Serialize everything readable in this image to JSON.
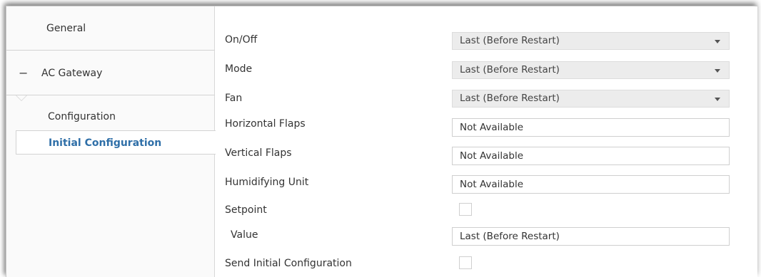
{
  "sidebar": {
    "general": "General",
    "ac_gateway": {
      "toggle": "−",
      "label": "AC Gateway"
    },
    "configuration": "Configuration",
    "initial_configuration": "Initial Configuration"
  },
  "params": {
    "on_off": {
      "label": "On/Off",
      "value": "Last (Before Restart)"
    },
    "mode": {
      "label": "Mode",
      "value": "Last (Before Restart)"
    },
    "fan": {
      "label": "Fan",
      "value": "Last (Before Restart)"
    },
    "horizontal_flaps": {
      "label": "Horizontal Flaps",
      "value": "Not Available"
    },
    "vertical_flaps": {
      "label": "Vertical Flaps",
      "value": "Not Available"
    },
    "humidifying_unit": {
      "label": "Humidifying Unit",
      "value": "Not Available"
    },
    "setpoint": {
      "label": "Setpoint",
      "checked": false
    },
    "value": {
      "label": "Value",
      "value": "Last (Before Restart)"
    },
    "send_initial_configuration": {
      "label": "Send Initial Configuration",
      "checked": false
    }
  },
  "colors": {
    "accent": "#2f6fa8",
    "select_bg": "#ececec",
    "border": "#cfcfcf"
  },
  "icons": {
    "dropdown": "chevron-down-icon",
    "collapse": "minus-icon"
  }
}
